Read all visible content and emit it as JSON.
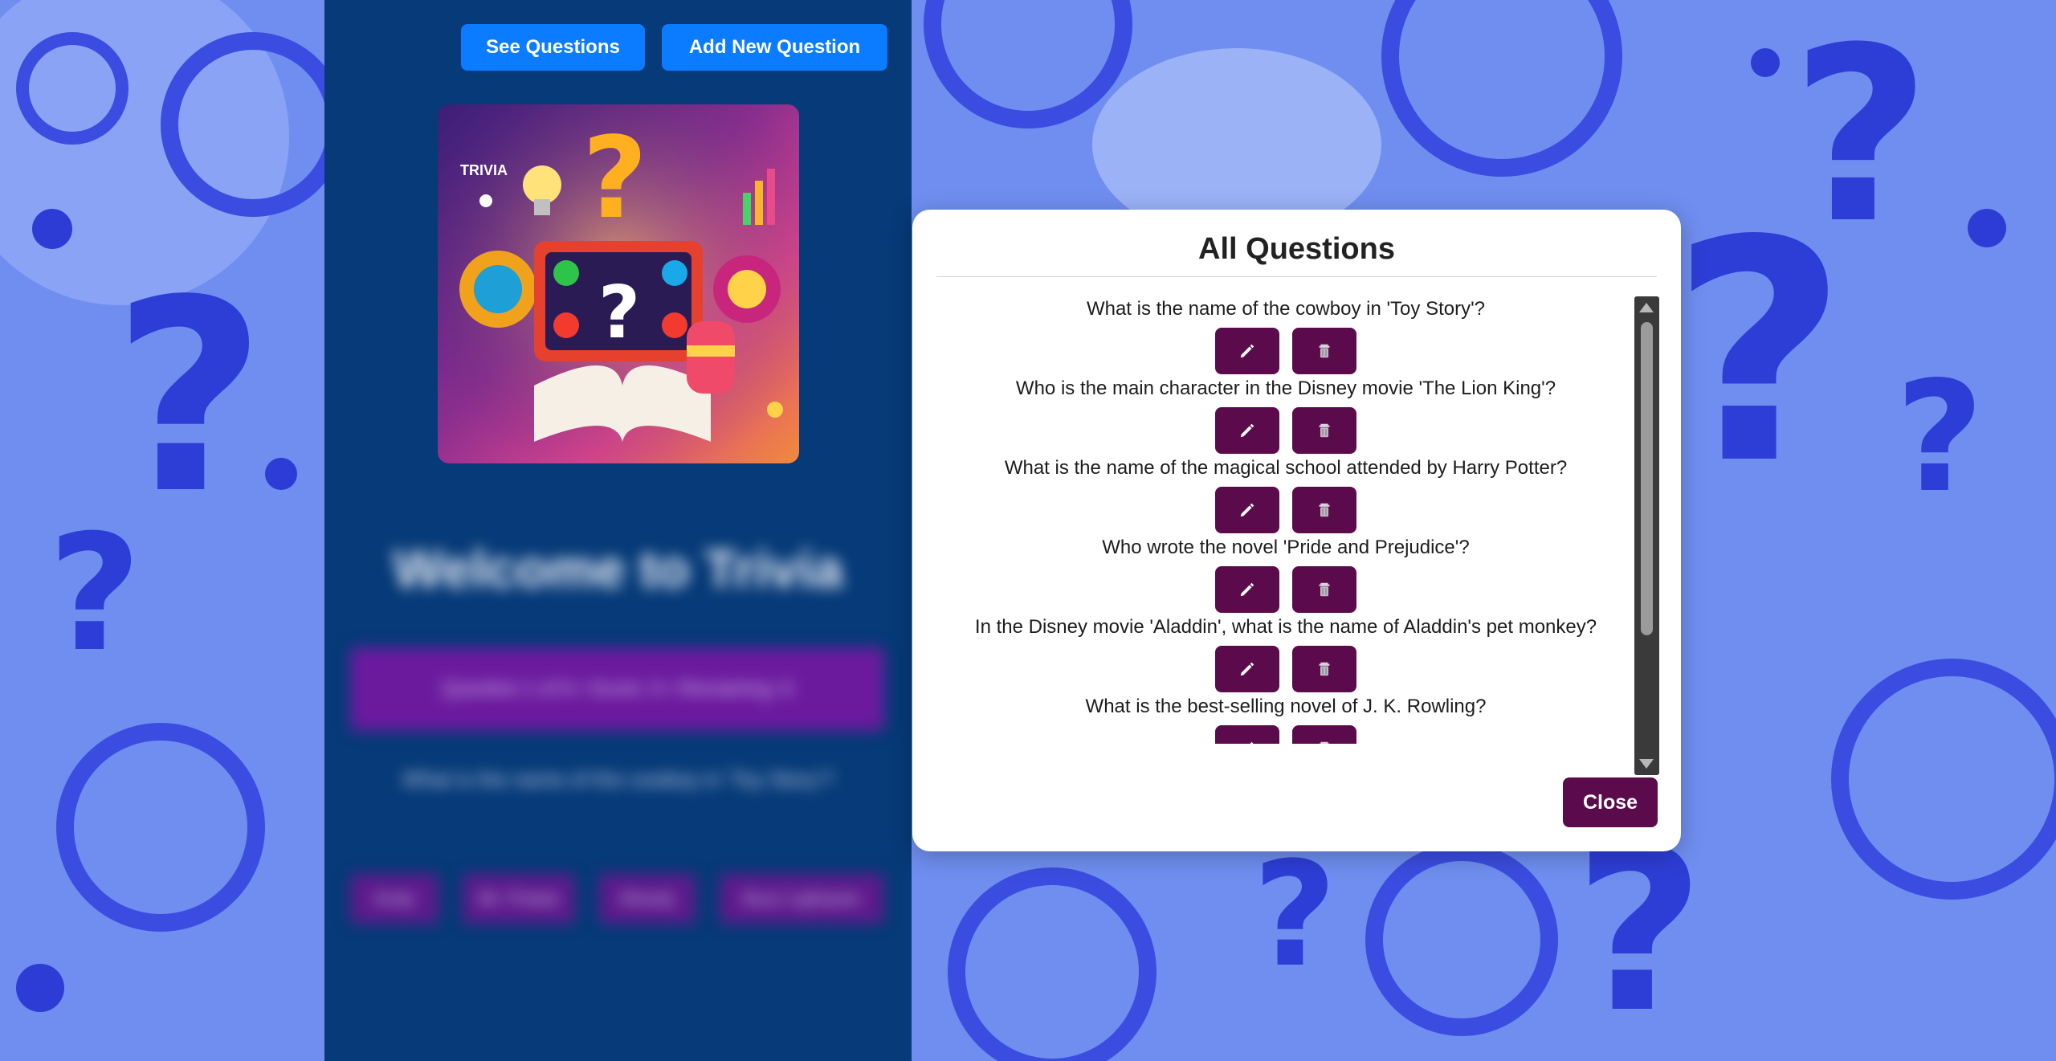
{
  "nav": {
    "see_questions_label": "See Questions",
    "add_question_label": "Add New Question"
  },
  "hero": {
    "image_caption": "TRIVIA"
  },
  "background_content": {
    "welcome_title": "Welcome to Trivia",
    "progress_text": "Question 1 of 6 • Score: 0 • Remaining: 6",
    "current_question": "What is the name of the cowboy in 'Toy Story'?",
    "answers": [
      "Andy",
      "Mr. Potato",
      "Woody",
      "Buzz Lightyear"
    ]
  },
  "modal": {
    "title": "All Questions",
    "close_label": "Close",
    "questions": [
      {
        "text": "What is the name of the cowboy in 'Toy Story'?"
      },
      {
        "text": "Who is the main character in the Disney movie 'The Lion King'?"
      },
      {
        "text": "What is the name of the magical school attended by Harry Potter?"
      },
      {
        "text": "Who wrote the novel 'Pride and Prejudice'?"
      },
      {
        "text": "In the Disney movie 'Aladdin', what is the name of Aladdin's pet monkey?"
      },
      {
        "text": "What is the best-selling novel of J. K. Rowling?"
      }
    ],
    "edit_icon": "pencil-icon",
    "delete_icon": "trash-icon"
  },
  "colors": {
    "app_bg": "#063a78",
    "nav_button": "#0b7bff",
    "action_button": "#5b0b4b",
    "page_bg": "#6f8ef0"
  }
}
